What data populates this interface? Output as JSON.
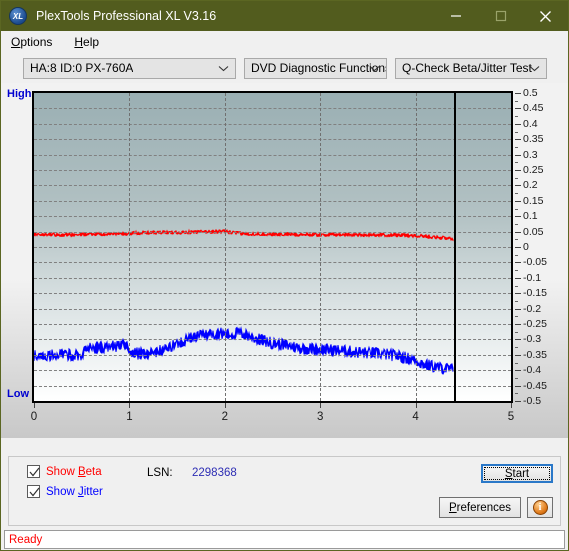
{
  "window": {
    "title": "PlexTools Professional XL V3.16",
    "logo_text": "XL",
    "minimize_icon": "minimize-icon",
    "maximize_icon": "maximize-icon",
    "close_icon": "close-icon",
    "titlebar_color": "#525c1e"
  },
  "menu": {
    "items": [
      {
        "label": "Options",
        "accel": "O"
      },
      {
        "label": "Help",
        "accel": "H"
      }
    ]
  },
  "toolbar": {
    "drive_select": {
      "value": "HA:8 ID:0  PX-760A",
      "options": [
        "HA:8 ID:0  PX-760A"
      ]
    },
    "function_select": {
      "value": "DVD Diagnostic Functions",
      "options": [
        "DVD Diagnostic Functions"
      ]
    },
    "test_select": {
      "value": "Q-Check Beta/Jitter Test",
      "options": [
        "Q-Check Beta/Jitter Test"
      ]
    }
  },
  "chart_labels": {
    "high": "High",
    "low": "Low"
  },
  "controls": {
    "show_beta": {
      "label": "Show Beta",
      "accel": "B",
      "checked": true,
      "color": "#ff0000"
    },
    "show_jitter": {
      "label": "Show Jitter",
      "accel": "J",
      "checked": true,
      "color": "#0000ff"
    },
    "lsn_label": "LSN:",
    "lsn_value": "2298368",
    "start_button": {
      "label": "Start",
      "accel": "S"
    },
    "preferences_button": {
      "label": "Preferences",
      "accel": "P"
    },
    "info_button": {
      "label": "i",
      "icon": "info-icon"
    }
  },
  "status": {
    "text": "Ready",
    "color": "#ff0000"
  },
  "chart_data": {
    "type": "line",
    "title": "Q-Check Beta/Jitter Test",
    "xlabel": "",
    "ylabel": "",
    "xlim": [
      0,
      5
    ],
    "ylim": [
      -0.5,
      0.5
    ],
    "grid": true,
    "legend": "none",
    "xticks": [
      0,
      1,
      2,
      3,
      4,
      5
    ],
    "yticks": [
      0.5,
      0.45,
      0.4,
      0.35,
      0.3,
      0.25,
      0.2,
      0.15,
      0.1,
      0.05,
      0,
      -0.05,
      -0.1,
      -0.15,
      -0.2,
      -0.25,
      -0.3,
      -0.35,
      -0.4,
      -0.45,
      -0.5
    ],
    "ytick_labels": [
      "0.5",
      "0.45",
      "0.4",
      "0.35",
      "0.3",
      "0.25",
      "0.2",
      "0.15",
      "0.1",
      "0.05",
      "0",
      "-0.05",
      "-0.1",
      "-0.15",
      "-0.2",
      "-0.25",
      "-0.3",
      "-0.35",
      "-0.4",
      "-0.45",
      "-0.5"
    ],
    "cursor_x": 4.4,
    "axis_left_label": "High",
    "axis_bottom_left_label": "Low",
    "series": [
      {
        "name": "Beta",
        "color": "#ff0000",
        "noise": 0.006,
        "x": [
          0.0,
          0.2,
          0.45,
          0.52,
          0.8,
          0.98,
          1.05,
          1.35,
          1.6,
          1.85,
          2.0,
          2.1,
          2.2,
          2.45,
          2.7,
          3.0,
          3.3,
          3.6,
          3.9,
          4.1,
          4.25,
          4.4
        ],
        "values": [
          0.04,
          0.04,
          0.04,
          0.041,
          0.042,
          0.043,
          0.046,
          0.047,
          0.048,
          0.05,
          0.05,
          0.046,
          0.043,
          0.042,
          0.041,
          0.04,
          0.04,
          0.039,
          0.038,
          0.035,
          0.031,
          0.026
        ]
      },
      {
        "name": "Jitter",
        "color": "#0000ff",
        "noise": 0.02,
        "x": [
          0.0,
          0.15,
          0.35,
          0.5,
          0.55,
          0.7,
          0.85,
          0.98,
          1.02,
          1.1,
          1.25,
          1.4,
          1.5,
          1.6,
          1.72,
          1.85,
          1.95,
          2.05,
          2.15,
          2.25,
          2.35,
          2.5,
          2.65,
          2.8,
          3.0,
          3.2,
          3.4,
          3.6,
          3.8,
          4.0,
          4.1,
          4.25,
          4.4
        ],
        "values": [
          -0.352,
          -0.352,
          -0.35,
          -0.349,
          -0.33,
          -0.326,
          -0.322,
          -0.318,
          -0.346,
          -0.346,
          -0.344,
          -0.33,
          -0.312,
          -0.3,
          -0.288,
          -0.282,
          -0.28,
          -0.286,
          -0.278,
          -0.288,
          -0.3,
          -0.312,
          -0.32,
          -0.328,
          -0.332,
          -0.336,
          -0.342,
          -0.346,
          -0.352,
          -0.368,
          -0.382,
          -0.392,
          -0.398
        ]
      }
    ]
  }
}
